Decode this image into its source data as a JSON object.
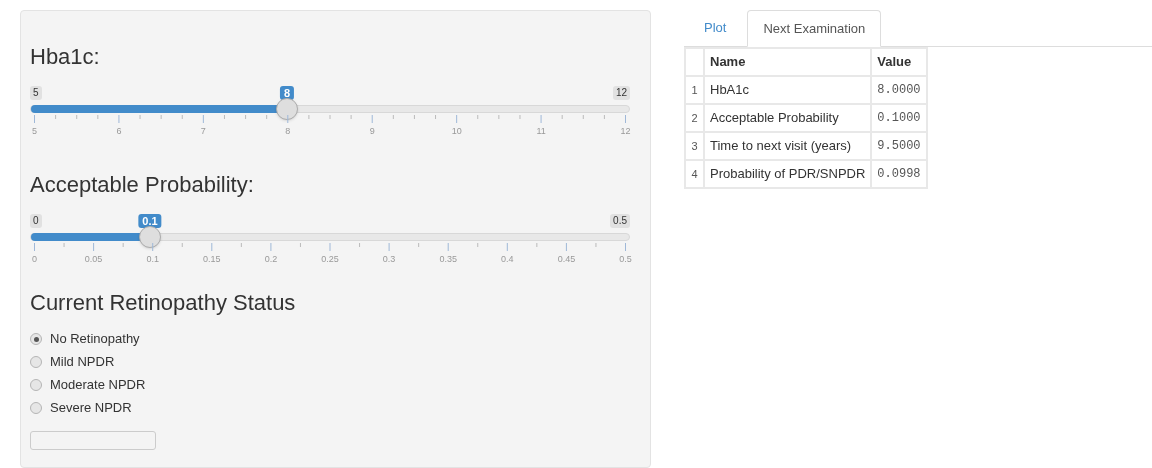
{
  "sliders": [
    {
      "label": "Hba1c:",
      "min_label": "5",
      "max_label": "12",
      "value_label": "8",
      "level": 0.4286,
      "ticks": [
        "5",
        "6",
        "7",
        "8",
        "9",
        "10",
        "11",
        "12"
      ]
    },
    {
      "label": "Acceptable Probability:",
      "min_label": "0",
      "max_label": "0.5",
      "value_label": "0.1",
      "level": 0.2,
      "ticks": [
        "0",
        "0.05",
        "0.1",
        "0.15",
        "0.2",
        "0.25",
        "0.3",
        "0.35",
        "0.4",
        "0.45",
        "0.5"
      ]
    }
  ],
  "status": {
    "title": "Current Retinopathy Status",
    "options": [
      {
        "label": "No Retinopathy",
        "selected": true
      },
      {
        "label": "Mild NPDR",
        "selected": false
      },
      {
        "label": "Moderate NPDR",
        "selected": false
      },
      {
        "label": "Severe NPDR",
        "selected": false
      }
    ]
  },
  "tabs": [
    {
      "label": "Plot",
      "selected": false
    },
    {
      "label": "Next Examination",
      "selected": true
    }
  ],
  "table": {
    "columns": [
      "Name",
      "Value"
    ],
    "rows": [
      {
        "index": "1",
        "name": "HbA1c",
        "value": "8.0000"
      },
      {
        "index": "2",
        "name": "Acceptable Probability",
        "value": "0.1000"
      },
      {
        "index": "3",
        "name": "Time to next visit (years)",
        "value": "9.5000"
      },
      {
        "index": "4",
        "name": "Probability of PDR/SNPDR",
        "value": "0.0998"
      }
    ]
  }
}
